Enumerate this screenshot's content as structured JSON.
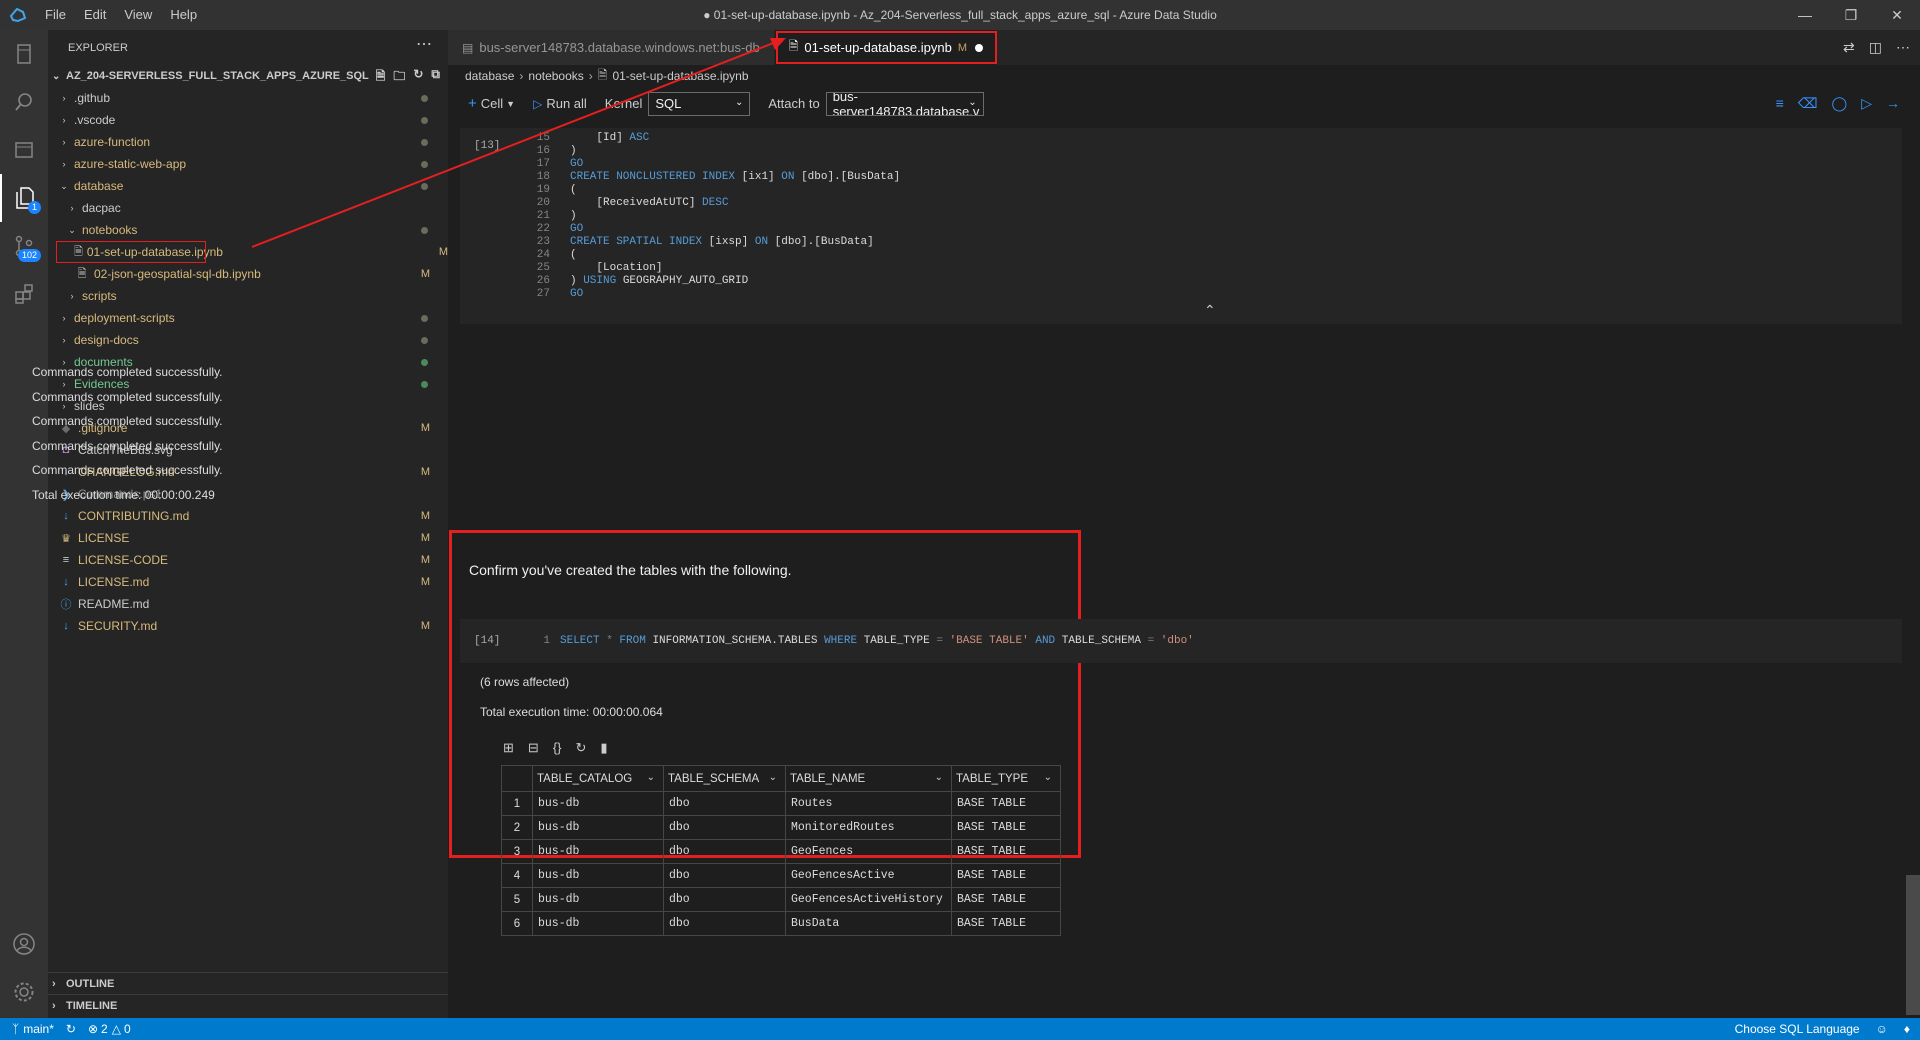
{
  "window": {
    "title": "● 01-set-up-database.ipynb - Az_204-Serverless_full_stack_apps_azure_sql - Azure Data Studio",
    "menu": [
      "File",
      "Edit",
      "View",
      "Help"
    ]
  },
  "activity": {
    "source_control_badge": "102",
    "notebook_badge": "1"
  },
  "explorer": {
    "header": "EXPLORER",
    "root": "AZ_204-SERVERLESS_FULL_STACK_APPS_AZURE_SQL",
    "items": [
      {
        "label": ".github",
        "depth": 0,
        "type": "folder",
        "status": "dot",
        "color": "#cccccc"
      },
      {
        "label": ".vscode",
        "depth": 0,
        "type": "folder",
        "status": "dot",
        "color": "#cccccc"
      },
      {
        "label": "azure-function",
        "depth": 0,
        "type": "folder",
        "status": "dot",
        "color": "#d7ba7d"
      },
      {
        "label": "azure-static-web-app",
        "depth": 0,
        "type": "folder",
        "status": "dot",
        "color": "#d7ba7d"
      },
      {
        "label": "database",
        "depth": 0,
        "type": "folder-open",
        "status": "dot",
        "color": "#d7ba7d"
      },
      {
        "label": "dacpac",
        "depth": 1,
        "type": "folder",
        "status": "",
        "color": "#cccccc"
      },
      {
        "label": "notebooks",
        "depth": 1,
        "type": "folder-open",
        "status": "dot",
        "color": "#d7ba7d"
      },
      {
        "label": "01-set-up-database.ipynb",
        "depth": 2,
        "type": "notebook",
        "status": "M",
        "color": "#d7ba7d",
        "selected": true
      },
      {
        "label": "02-json-geospatial-sql-db.ipynb",
        "depth": 2,
        "type": "notebook",
        "status": "M",
        "color": "#d7ba7d"
      },
      {
        "label": "scripts",
        "depth": 1,
        "type": "folder",
        "status": "",
        "color": "#d7ba7d"
      },
      {
        "label": "deployment-scripts",
        "depth": 0,
        "type": "folder",
        "status": "dot",
        "color": "#d7ba7d"
      },
      {
        "label": "design-docs",
        "depth": 0,
        "type": "folder",
        "status": "dot",
        "color": "#d7ba7d"
      },
      {
        "label": "documents",
        "depth": 0,
        "type": "folder",
        "status": "dot-green",
        "color": "#73c991"
      },
      {
        "label": "Evidences",
        "depth": 0,
        "type": "folder",
        "status": "dot-green",
        "color": "#73c991"
      },
      {
        "label": "slides",
        "depth": 0,
        "type": "folder",
        "status": "",
        "color": "#cccccc"
      },
      {
        "label": ".gitignore",
        "depth": 0,
        "type": "git",
        "status": "M",
        "color": "#d7ba7d"
      },
      {
        "label": "CatchTheBus.svg",
        "depth": 0,
        "type": "svg",
        "status": "",
        "color": "#cccccc"
      },
      {
        "label": "CHANGELOG.md",
        "depth": 0,
        "type": "md",
        "status": "M",
        "color": "#d7ba7d"
      },
      {
        "label": "Commands.ps1",
        "depth": 0,
        "type": "ps1",
        "status": "",
        "color": "#8c8c8c"
      },
      {
        "label": "CONTRIBUTING.md",
        "depth": 0,
        "type": "md",
        "status": "M",
        "color": "#d7ba7d"
      },
      {
        "label": "LICENSE",
        "depth": 0,
        "type": "license",
        "status": "M",
        "color": "#d7ba7d"
      },
      {
        "label": "LICENSE-CODE",
        "depth": 0,
        "type": "text",
        "status": "M",
        "color": "#d7ba7d"
      },
      {
        "label": "LICENSE.md",
        "depth": 0,
        "type": "md",
        "status": "M",
        "color": "#d7ba7d"
      },
      {
        "label": "README.md",
        "depth": 0,
        "type": "info",
        "status": "",
        "color": "#cccccc"
      },
      {
        "label": "SECURITY.md",
        "depth": 0,
        "type": "md",
        "status": "M",
        "color": "#d7ba7d"
      }
    ],
    "outline": "OUTLINE",
    "timeline": "TIMELINE"
  },
  "tabs": [
    {
      "label": "bus-server148783.database.windows.net:bus-db",
      "active": false
    },
    {
      "label": "01-set-up-database.ipynb",
      "active": true,
      "modified": "M"
    }
  ],
  "breadcrumb": [
    "database",
    "notebooks",
    "01-set-up-database.ipynb"
  ],
  "toolbar": {
    "cell": "Cell",
    "run_all": "Run all",
    "kernel_label": "Kernel",
    "kernel_value": "SQL",
    "attach_label": "Attach to",
    "attach_value": "bus-server148783.database.v"
  },
  "cell13": {
    "exec": "[13]",
    "lines": [
      {
        "n": "15",
        "tokens": [
          [
            "pl",
            "    [Id] "
          ],
          [
            "kw",
            "ASC"
          ]
        ]
      },
      {
        "n": "16",
        "tokens": [
          [
            "pl",
            ")"
          ]
        ]
      },
      {
        "n": "17",
        "tokens": [
          [
            "kw",
            "GO"
          ]
        ]
      },
      {
        "n": "18",
        "tokens": [
          [
            "kw",
            "CREATE NONCLUSTERED INDEX "
          ],
          [
            "pl",
            "[ix1] "
          ],
          [
            "kw",
            "ON "
          ],
          [
            "pl",
            "[dbo].[BusData]"
          ]
        ]
      },
      {
        "n": "19",
        "tokens": [
          [
            "pl",
            "("
          ]
        ]
      },
      {
        "n": "20",
        "tokens": [
          [
            "pl",
            "    [ReceivedAtUTC] "
          ],
          [
            "kw",
            "DESC"
          ]
        ]
      },
      {
        "n": "21",
        "tokens": [
          [
            "pl",
            ")"
          ]
        ]
      },
      {
        "n": "22",
        "tokens": [
          [
            "kw",
            "GO"
          ]
        ]
      },
      {
        "n": "23",
        "tokens": [
          [
            "kw",
            "CREATE SPATIAL INDEX "
          ],
          [
            "pl",
            "[ixsp] "
          ],
          [
            "kw",
            "ON "
          ],
          [
            "pl",
            "[dbo].[BusData]"
          ]
        ]
      },
      {
        "n": "24",
        "tokens": [
          [
            "pl",
            "("
          ]
        ]
      },
      {
        "n": "25",
        "tokens": [
          [
            "pl",
            "    [Location]"
          ]
        ]
      },
      {
        "n": "26",
        "tokens": [
          [
            "pl",
            ") "
          ],
          [
            "kw",
            "USING "
          ],
          [
            "pl",
            "GEOGRAPHY_AUTO_GRID"
          ]
        ]
      },
      {
        "n": "27",
        "tokens": [
          [
            "kw",
            "GO"
          ]
        ]
      }
    ],
    "output": [
      "Commands completed successfully.",
      "Commands completed successfully.",
      "Commands completed successfully.",
      "Commands completed successfully.",
      "Commands completed successfully.",
      "Total execution time: 00:00:00.249"
    ]
  },
  "markdown": "Confirm you've created the tables with the following.",
  "cell14": {
    "exec": "[14]",
    "line_no": "1",
    "tokens": [
      [
        "kw",
        "SELECT "
      ],
      [
        "gr",
        "* "
      ],
      [
        "kw",
        "FROM "
      ],
      [
        "pl",
        "INFORMATION_SCHEMA.TABLES "
      ],
      [
        "kw",
        "WHERE "
      ],
      [
        "pl",
        "TABLE_TYPE "
      ],
      [
        "gr",
        "= "
      ],
      [
        "str",
        "'BASE TABLE' "
      ],
      [
        "kw",
        "AND "
      ],
      [
        "pl",
        "TABLE_SCHEMA "
      ],
      [
        "gr",
        "= "
      ],
      [
        "str",
        "'dbo'"
      ]
    ],
    "rows_affected": "(6 rows affected)",
    "exec_time": "Total execution time: 00:00:00.064"
  },
  "result_grid": {
    "columns": [
      "TABLE_CATALOG",
      "TABLE_SCHEMA",
      "TABLE_NAME",
      "TABLE_TYPE"
    ],
    "rows": [
      [
        "1",
        "bus-db",
        "dbo",
        "Routes",
        "BASE TABLE"
      ],
      [
        "2",
        "bus-db",
        "dbo",
        "MonitoredRoutes",
        "BASE TABLE"
      ],
      [
        "3",
        "bus-db",
        "dbo",
        "GeoFences",
        "BASE TABLE"
      ],
      [
        "4",
        "bus-db",
        "dbo",
        "GeoFencesActive",
        "BASE TABLE"
      ],
      [
        "5",
        "bus-db",
        "dbo",
        "GeoFencesActiveHistory",
        "BASE TABLE"
      ],
      [
        "6",
        "bus-db",
        "dbo",
        "BusData",
        "BASE TABLE"
      ]
    ]
  },
  "statusbar": {
    "branch": "main*",
    "errors": "2",
    "warnings": "0",
    "language": "Choose SQL Language"
  },
  "colors": {
    "accent": "#007acc",
    "highlight": "#e51f1f",
    "modified": "#d7ba7d"
  }
}
